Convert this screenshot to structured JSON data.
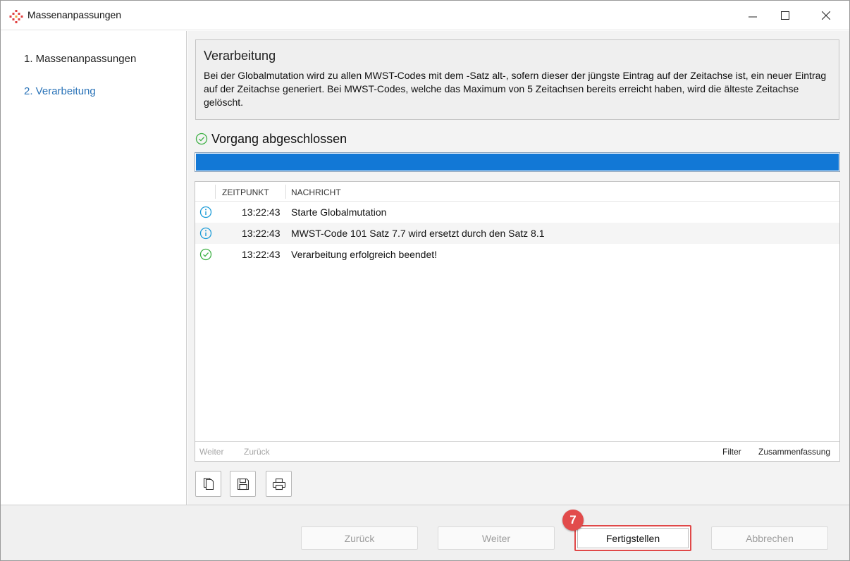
{
  "window": {
    "title": "Massenanpassungen"
  },
  "sidebar": {
    "steps": [
      {
        "label": "1. Massenanpassungen"
      },
      {
        "label": "2. Verarbeitung"
      }
    ]
  },
  "info": {
    "title": "Verarbeitung",
    "description": "Bei der Globalmutation wird zu allen MWST-Codes mit dem -Satz alt-, sofern dieser der jüngste Eintrag auf der Zeitachse ist, ein neuer Eintrag auf der Zeitachse generiert. Bei MWST-Codes, welche das Maximum von 5 Zeitachsen bereits erreicht haben, wird die älteste Zeitachse gelöscht."
  },
  "status": {
    "text": "Vorgang abgeschlossen",
    "progress_percent": 100
  },
  "log": {
    "columns": {
      "time": "ZEITPUNKT",
      "message": "NACHRICHT"
    },
    "rows": [
      {
        "icon": "info-icon",
        "time": "13:22:43",
        "message": "Starte Globalmutation"
      },
      {
        "icon": "info-icon",
        "time": "13:22:43",
        "message": "MWST-Code 101 Satz 7.7 wird ersetzt durch den Satz 8.1"
      },
      {
        "icon": "check-icon",
        "time": "13:22:43",
        "message": "Verarbeitung erfolgreich beendet!"
      }
    ],
    "footer": {
      "weiter": "Weiter",
      "zurueck": "Zurück",
      "filter": "Filter",
      "summary": "Zusammenfassung"
    }
  },
  "buttons": {
    "back": "Zurück",
    "next": "Weiter",
    "finish": "Fertigstellen",
    "cancel": "Abbrechen"
  },
  "annotation": {
    "badge": "7"
  },
  "colors": {
    "accent_blue": "#1278d6",
    "link_blue": "#2a73b8",
    "success_green": "#3cb043",
    "info_cyan": "#1a9bd7",
    "badge_red": "#e24b4b"
  }
}
